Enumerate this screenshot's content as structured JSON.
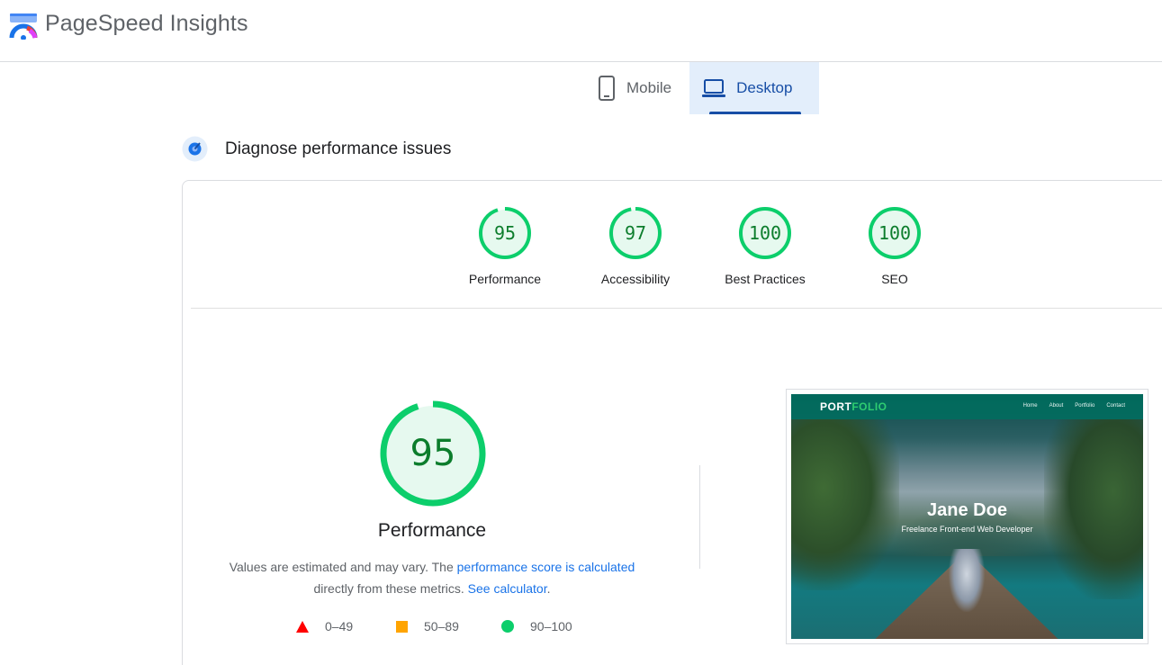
{
  "app": {
    "title": "PageSpeed Insights"
  },
  "tabs": [
    {
      "label": "Mobile",
      "icon": "phone-icon",
      "active": false
    },
    {
      "label": "Desktop",
      "icon": "laptop-icon",
      "active": true
    }
  ],
  "section": {
    "title": "Diagnose performance issues",
    "icon": "diagnose-icon"
  },
  "scores": [
    {
      "label": "Performance",
      "value": "95",
      "fraction": 0.95
    },
    {
      "label": "Accessibility",
      "value": "97",
      "fraction": 0.97
    },
    {
      "label": "Best Practices",
      "value": "100",
      "fraction": 1.0
    },
    {
      "label": "SEO",
      "value": "100",
      "fraction": 1.0
    }
  ],
  "performance": {
    "score": "95",
    "fraction": 0.95,
    "label": "Performance",
    "desc_part1": "Values are estimated and may vary. The ",
    "desc_link1": "performance score is calculated",
    "desc_part2": "directly from these metrics. ",
    "desc_link2": "See calculator",
    "desc_part3": "."
  },
  "legend": [
    {
      "range": "0–49",
      "shape": "triangle",
      "color": "#ff0000"
    },
    {
      "range": "50–89",
      "shape": "square",
      "color": "#ffa400"
    },
    {
      "range": "90–100",
      "shape": "circle",
      "color": "#0cce6b"
    }
  ],
  "screenshot": {
    "brand_a": "PORT",
    "brand_b": "FOLIO",
    "nav": [
      "Home",
      "About",
      "Portfolio",
      "Contact"
    ],
    "name": "Jane Doe",
    "subtitle": "Freelance Front-end Web Developer"
  },
  "colors": {
    "pass": "#0cce6b",
    "pass_text": "#0c7d2c",
    "pass_bg": "#e6f9ef",
    "accent": "#174ea6",
    "link": "#1a73e8"
  }
}
